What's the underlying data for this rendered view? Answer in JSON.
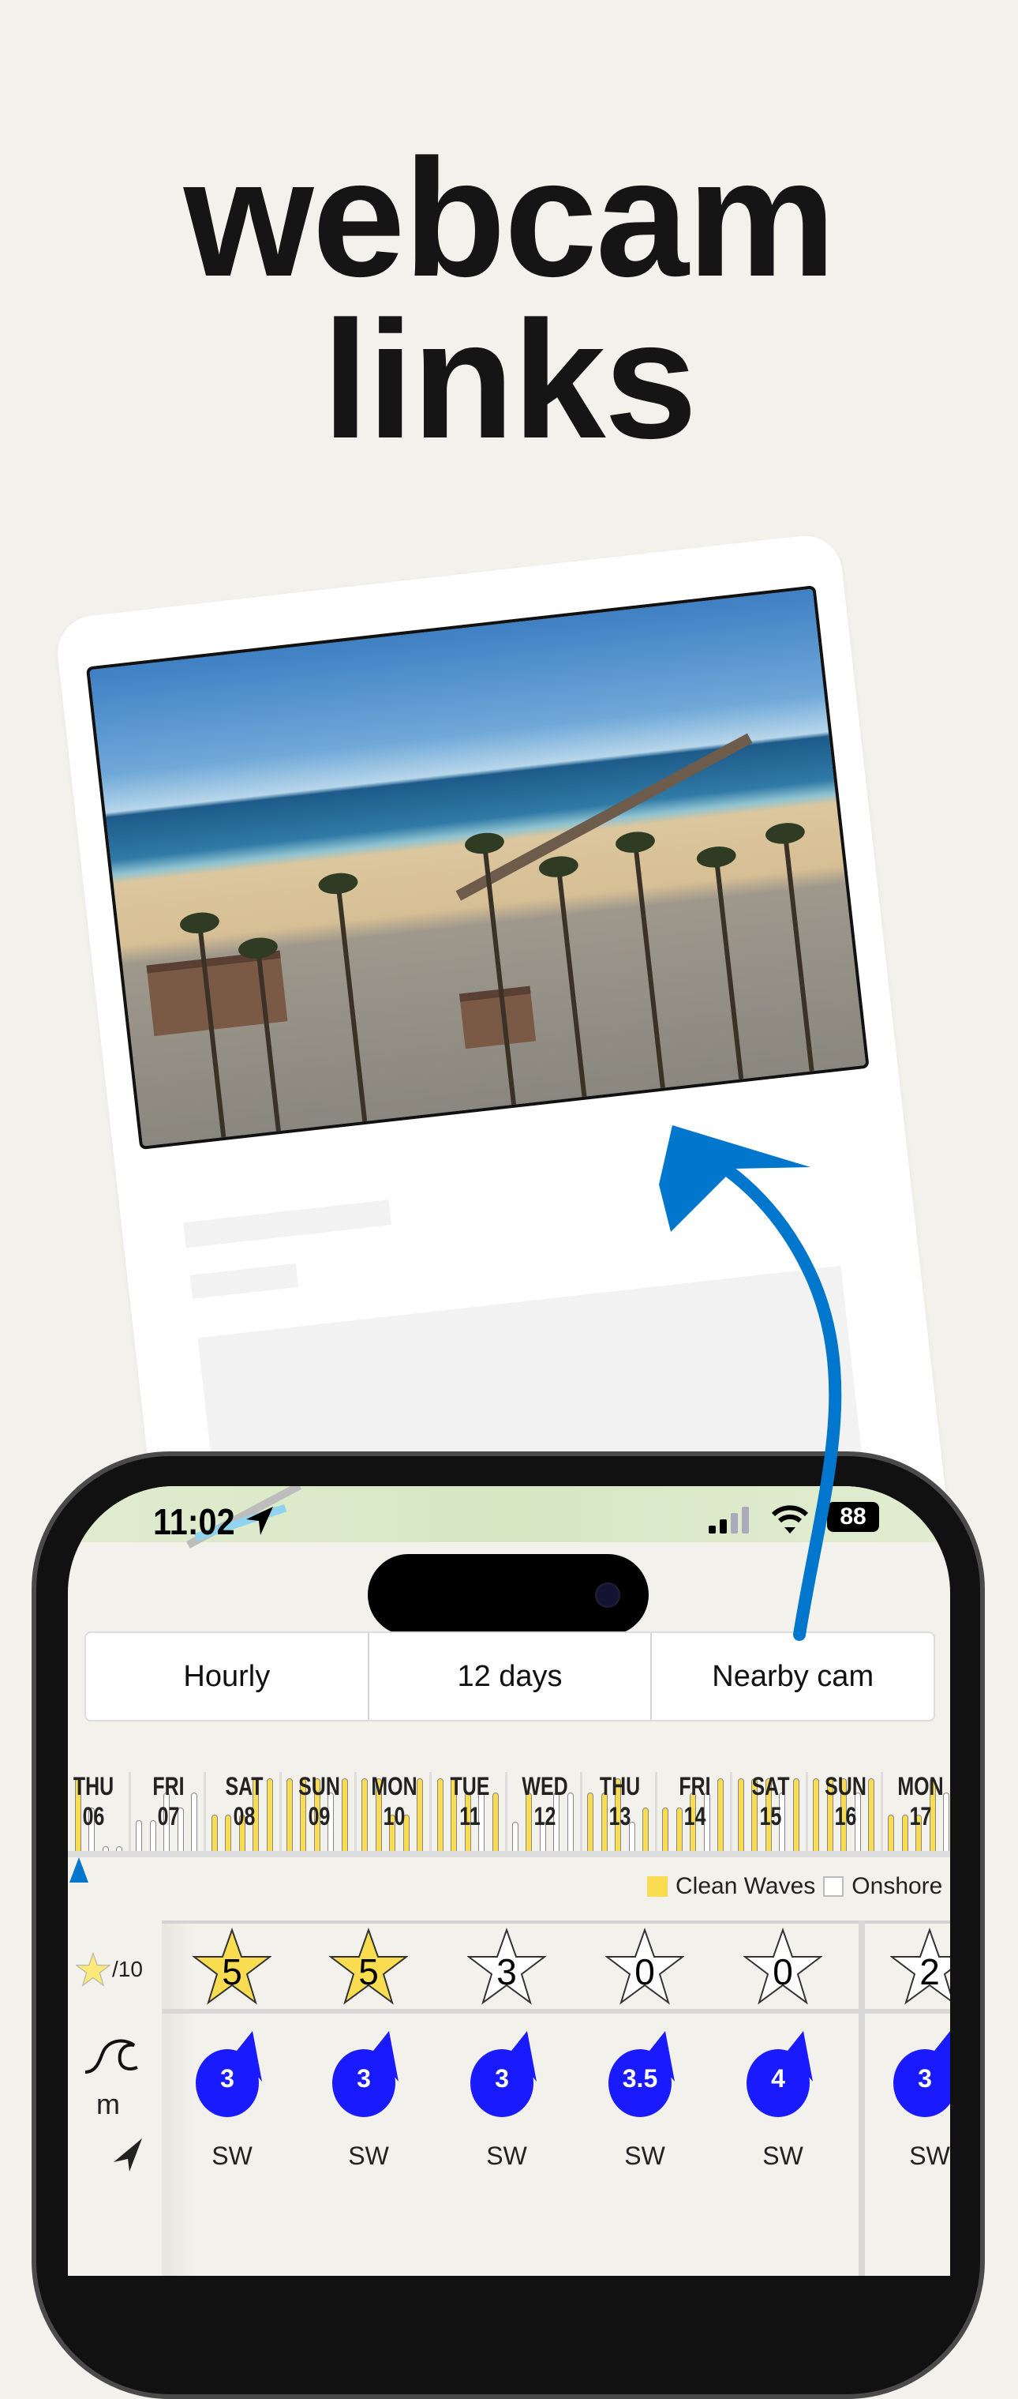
{
  "headline": {
    "line1": "webcam",
    "line2": "links"
  },
  "status_bar": {
    "time": "11:02",
    "battery": "88",
    "icons": [
      "location-arrow-icon",
      "signal-icon",
      "wifi-icon",
      "battery-icon"
    ]
  },
  "segmented": {
    "items": [
      "Hourly",
      "12 days",
      "Nearby cam"
    ]
  },
  "forecast": {
    "days": [
      {
        "name": "THU",
        "date": "06",
        "bars": [
          1,
          1,
          0.6,
          0.05,
          0.05
        ],
        "clean": [
          1,
          1,
          0,
          0,
          0
        ]
      },
      {
        "name": "FRI",
        "date": "07",
        "bars": [
          0.42,
          0.42,
          0.8,
          0.6,
          0.8
        ],
        "clean": [
          0,
          0,
          0,
          0,
          0
        ]
      },
      {
        "name": "SAT",
        "date": "08",
        "bars": [
          0.5,
          0.5,
          0.5,
          1,
          1
        ],
        "clean": [
          1,
          1,
          1,
          1,
          1
        ]
      },
      {
        "name": "SUN",
        "date": "09",
        "bars": [
          1,
          1,
          1,
          0.8,
          1
        ],
        "clean": [
          1,
          1,
          1,
          0,
          1
        ]
      },
      {
        "name": "MON",
        "date": "10",
        "bars": [
          1,
          1,
          0.5,
          0.5,
          1
        ],
        "clean": [
          1,
          1,
          1,
          1,
          1
        ]
      },
      {
        "name": "TUE",
        "date": "11",
        "bars": [
          1,
          1,
          0.8,
          0.8,
          0.8
        ],
        "clean": [
          1,
          1,
          1,
          0,
          1
        ]
      },
      {
        "name": "WED",
        "date": "12",
        "bars": [
          0.4,
          0.8,
          0.4,
          0.8,
          0.8
        ],
        "clean": [
          0,
          1,
          0,
          0,
          0
        ]
      },
      {
        "name": "THU",
        "date": "13",
        "bars": [
          0.8,
          0.8,
          1,
          0.4,
          0.6
        ],
        "clean": [
          1,
          1,
          1,
          0,
          1
        ]
      },
      {
        "name": "FRI",
        "date": "14",
        "bars": [
          0.6,
          0.6,
          0.8,
          0.8,
          1
        ],
        "clean": [
          1,
          1,
          1,
          0,
          1
        ]
      },
      {
        "name": "SAT",
        "date": "15",
        "bars": [
          1,
          1,
          1,
          0.8,
          1
        ],
        "clean": [
          1,
          1,
          1,
          0,
          1
        ]
      },
      {
        "name": "SUN",
        "date": "16",
        "bars": [
          1,
          1,
          1,
          0.8,
          1
        ],
        "clean": [
          1,
          1,
          1,
          0,
          1
        ]
      },
      {
        "name": "MON",
        "date": "17",
        "bars": [
          0.5,
          0.5,
          0.5,
          1,
          0.8
        ],
        "clean": [
          1,
          1,
          1,
          1,
          0
        ]
      }
    ],
    "legend": {
      "clean": "Clean Waves",
      "onshore": "Onshore"
    },
    "colors": {
      "clean": "#f9dc4f",
      "onshore": "#ffffff",
      "swell": "#1a1aff",
      "arrow": "#0077cc"
    }
  },
  "table": {
    "left": {
      "rating_unit": "/10",
      "swell_unit": "m"
    },
    "columns": [
      {
        "rating": "5",
        "swell": "3",
        "dir": "SW"
      },
      {
        "rating": "5",
        "swell": "3",
        "dir": "SW"
      },
      {
        "rating": "3",
        "swell": "3",
        "dir": "SW"
      },
      {
        "rating": "0",
        "swell": "3.5",
        "dir": "SW"
      },
      {
        "rating": "0",
        "swell": "4",
        "dir": "SW"
      },
      {
        "rating": "2",
        "swell": "3",
        "dir": "SW"
      }
    ]
  }
}
